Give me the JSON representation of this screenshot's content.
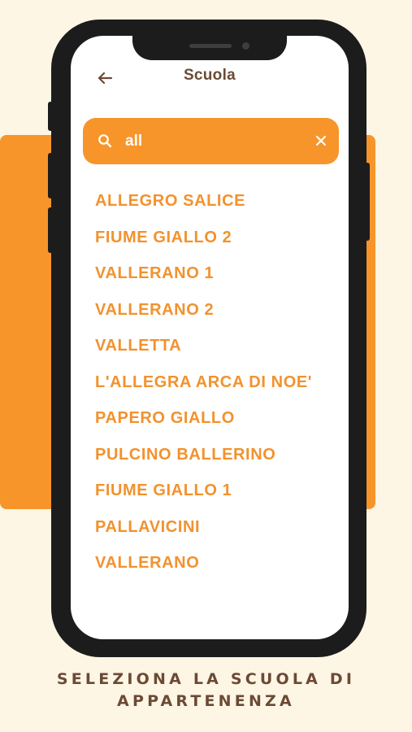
{
  "header": {
    "title": "Scuola",
    "back_icon": "arrow-left-icon"
  },
  "search": {
    "value": "all",
    "search_icon": "search-icon",
    "clear_icon": "close-icon"
  },
  "results": [
    "ALLEGRO SALICE",
    "FIUME GIALLO 2",
    "VALLERANO 1",
    "VALLERANO 2",
    "VALLETTA",
    "L'ALLEGRA ARCA DI NOE'",
    "PAPERO GIALLO",
    "PULCINO BALLERINO",
    "FIUME GIALLO 1",
    "PALLAVICINI",
    "VALLERANO"
  ],
  "caption": {
    "line1": "SELEZIONA LA SCUOLA DI",
    "line2": "APPARTENENZA"
  },
  "colors": {
    "accent": "#f7952a",
    "text_brown": "#6b4a35",
    "background": "#fdf6e4",
    "phone_frame": "#1c1c1c"
  }
}
